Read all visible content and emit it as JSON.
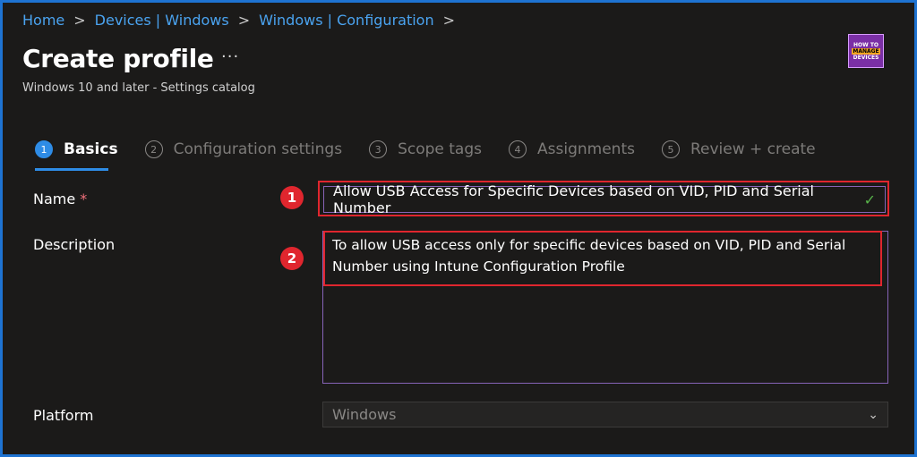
{
  "breadcrumb": {
    "items": [
      "Home",
      "Devices | Windows",
      "Windows | Configuration"
    ],
    "separator": ">"
  },
  "page": {
    "title": "Create profile",
    "more": "···",
    "subtitle": "Windows 10 and later - Settings catalog"
  },
  "logo": {
    "line1": "HOW TO",
    "line2": "MANAGE",
    "line3": "DEVICES"
  },
  "steps": [
    {
      "num": "1",
      "label": "Basics",
      "active": true
    },
    {
      "num": "2",
      "label": "Configuration settings"
    },
    {
      "num": "3",
      "label": "Scope tags"
    },
    {
      "num": "4",
      "label": "Assignments"
    },
    {
      "num": "5",
      "label": "Review + create"
    }
  ],
  "form": {
    "name_label": "Name",
    "required_mark": "*",
    "name_value": "Allow USB Access for Specific Devices based on VID, PID and Serial Number",
    "description_label": "Description",
    "description_value": "To allow USB access only for specific devices based on VID, PID and Serial Number using Intune Configuration Profile",
    "platform_label": "Platform",
    "platform_value": "Windows"
  },
  "annotations": {
    "badge1": "1",
    "badge2": "2"
  },
  "colors": {
    "accent": "#2e8ce6",
    "highlight": "#e0262e",
    "border": "#1e73d2"
  }
}
